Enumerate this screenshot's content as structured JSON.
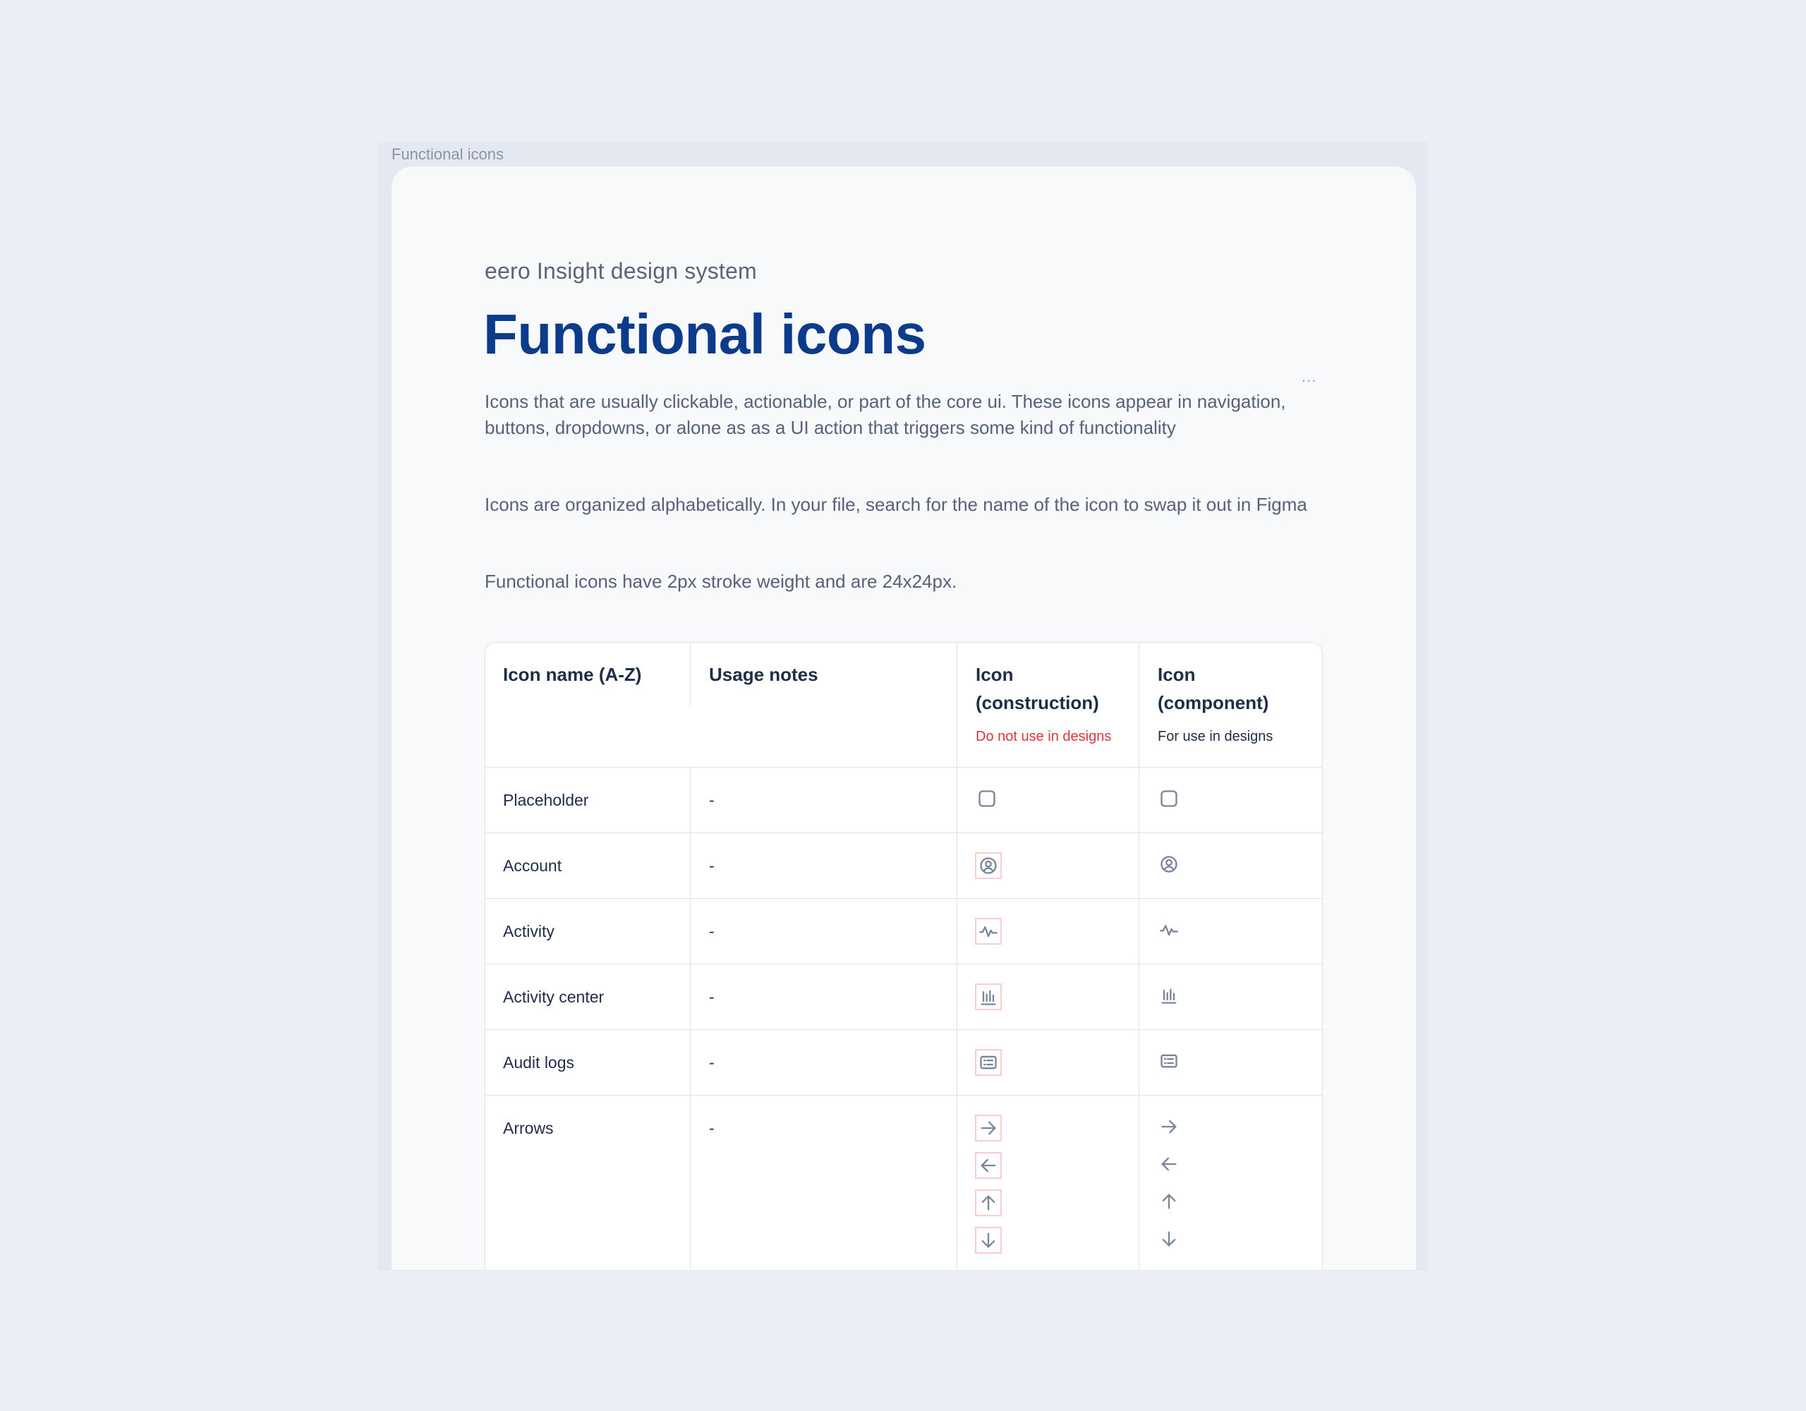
{
  "frame": {
    "label": "Functional icons"
  },
  "header": {
    "eyebrow": "eero Insight design system",
    "title": "Functional icons",
    "menu_dots": "...",
    "paragraphs": [
      "Icons that are usually clickable, actionable, or part of the core ui. These icons appear in navigation, buttons, dropdowns, or alone as as a UI action that triggers some kind of functionality",
      "Icons are organized alphabetically. In your file, search for the name of the icon to swap it out in Figma",
      "Functional icons have 2px stroke weight and are 24x24px."
    ]
  },
  "table": {
    "columns": {
      "name": "Icon name (A-Z)",
      "notes": "Usage notes",
      "construction_line1": "Icon",
      "construction_line2": "(construction)",
      "construction_note": "Do not use in designs",
      "component_line1": "Icon",
      "component_line2": "(component)",
      "component_note": "For use in designs"
    },
    "colors": {
      "warning": "#d9363e",
      "construction_border": "#f7cdd1",
      "icon_stroke": "#7a8599"
    },
    "rows": [
      {
        "name": "Placeholder",
        "notes": "-",
        "icons": [
          "placeholder-icon"
        ]
      },
      {
        "name": "Account",
        "notes": "-",
        "icons": [
          "account-icon"
        ]
      },
      {
        "name": "Activity",
        "notes": "-",
        "icons": [
          "activity-icon"
        ]
      },
      {
        "name": "Activity center",
        "notes": "-",
        "icons": [
          "activity-center-icon"
        ]
      },
      {
        "name": "Audit logs",
        "notes": "-",
        "icons": [
          "audit-logs-icon"
        ]
      },
      {
        "name": "Arrows",
        "notes": "-",
        "icons": [
          "arrow-right-icon",
          "arrow-left-icon",
          "arrow-up-icon",
          "arrow-down-icon"
        ]
      }
    ]
  }
}
